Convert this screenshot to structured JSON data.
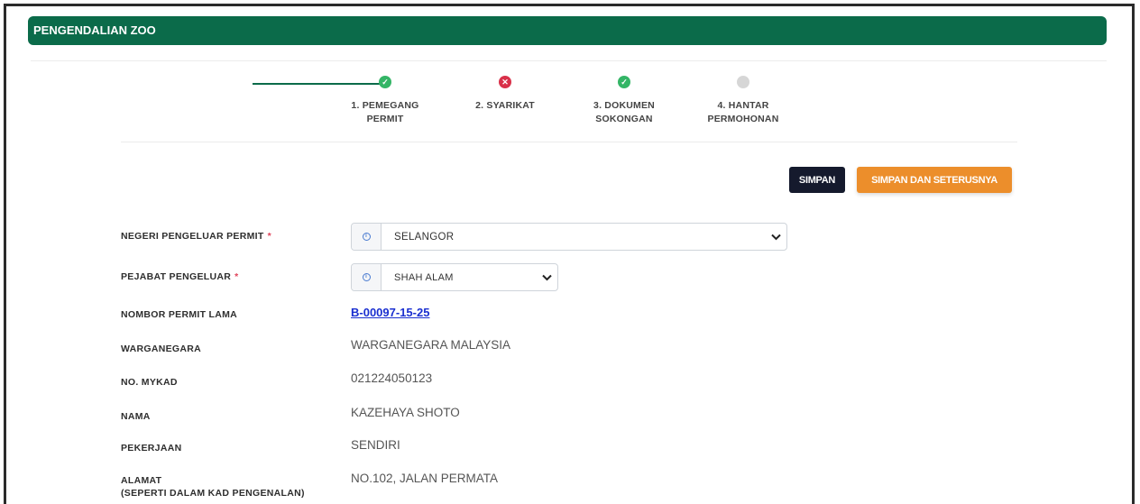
{
  "header": {
    "title": "PENGENDALIAN ZOO"
  },
  "stepper": {
    "steps": [
      {
        "line1": "1. PEMEGANG",
        "line2": "PERMIT",
        "status": "ok"
      },
      {
        "line1": "2. SYARIKAT",
        "line2": "",
        "status": "error"
      },
      {
        "line1": "3. DOKUMEN",
        "line2": "SOKONGAN",
        "status": "ok"
      },
      {
        "line1": "4. HANTAR",
        "line2": "PERMOHONAN",
        "status": "pending"
      }
    ]
  },
  "actions": {
    "save_label": "SIMPAN",
    "save_next_label": "SIMPAN DAN SETERUSNYA"
  },
  "form": {
    "negeri": {
      "label": "NEGERI PENGELUAR PERMIT",
      "required": "*",
      "value": "SELANGOR"
    },
    "pejabat": {
      "label": "PEJABAT PENGELUAR",
      "required": "*",
      "value": "SHAH ALAM"
    },
    "permit_lama": {
      "label": "NOMBOR PERMIT LAMA",
      "value": "B-00097-15-25"
    },
    "warganegara": {
      "label": "WARGANEGARA",
      "value": "WARGANEGARA MALAYSIA"
    },
    "mykad": {
      "label": "NO. MYKAD",
      "value": "021224050123"
    },
    "nama": {
      "label": "NAMA",
      "value": "KAZEHAYA SHOTO"
    },
    "pekerjaan": {
      "label": "PEKERJAAN",
      "value": "SENDIRI"
    },
    "alamat": {
      "label": "ALAMAT",
      "label2": "(SEPERTI DALAM KAD PENGENALAN)",
      "value": "NO.102, JALAN PERMATA"
    }
  },
  "colors": {
    "header_green": "#0b6b4a",
    "ok_green": "#34b566",
    "error_red": "#d9314a",
    "orange": "#ec8e2b",
    "navy": "#151a2d"
  }
}
